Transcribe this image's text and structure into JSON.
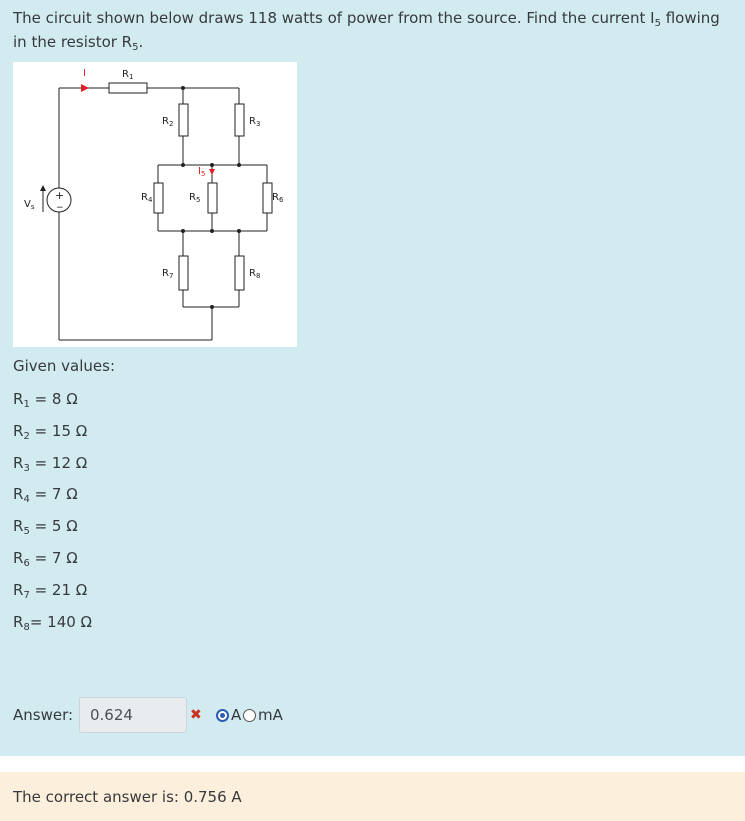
{
  "question": {
    "text_before_i": "The circuit shown below draws 118 watts of power from the source. Find the current I",
    "i_sub": "5",
    "text_mid": " flowing in the resistor R",
    "r_sub": "5",
    "text_end": "."
  },
  "circuit_labels": {
    "current_i": "I",
    "r1": "R",
    "r1_sub": "1",
    "r2": "R",
    "r2_sub": "2",
    "r3": "R",
    "r3_sub": "3",
    "r4": "R",
    "r4_sub": "4",
    "r5": "R",
    "r5_sub": "5",
    "r6": "R",
    "r6_sub": "6",
    "r7": "R",
    "r7_sub": "7",
    "r8": "R",
    "r8_sub": "8",
    "i5": "I",
    "i5_sub": "5",
    "vs": "V",
    "vs_sub": "s",
    "plus": "+",
    "minus": "−"
  },
  "given": {
    "title": "Given values:",
    "values": [
      {
        "sym": "R",
        "sub": "1",
        "text": " = 8 Ω"
      },
      {
        "sym": "R",
        "sub": "2",
        "text": " = 15 Ω"
      },
      {
        "sym": "R",
        "sub": "3",
        "text": " = 12 Ω"
      },
      {
        "sym": "R",
        "sub": "4",
        "text": " = 7 Ω"
      },
      {
        "sym": "R",
        "sub": "5",
        "text": " = 5 Ω"
      },
      {
        "sym": "R",
        "sub": "6",
        "text": " = 7 Ω"
      },
      {
        "sym": "R",
        "sub": "7",
        "text": " = 21 Ω"
      },
      {
        "sym": "R",
        "sub": "8",
        "text": "= 140 Ω"
      }
    ]
  },
  "answer": {
    "label": "Answer:",
    "value": "0.624",
    "incorrect_mark": "✖",
    "units": [
      {
        "label": "A",
        "selected": true
      },
      {
        "label": "mA",
        "selected": false
      }
    ]
  },
  "feedback": {
    "text": "The correct answer is: 0.756 A"
  },
  "colors": {
    "question_bg": "#d2ebf0",
    "feedback_bg": "#fcefdc",
    "incorrect": "#ca3120",
    "arrow": "#e02020"
  }
}
